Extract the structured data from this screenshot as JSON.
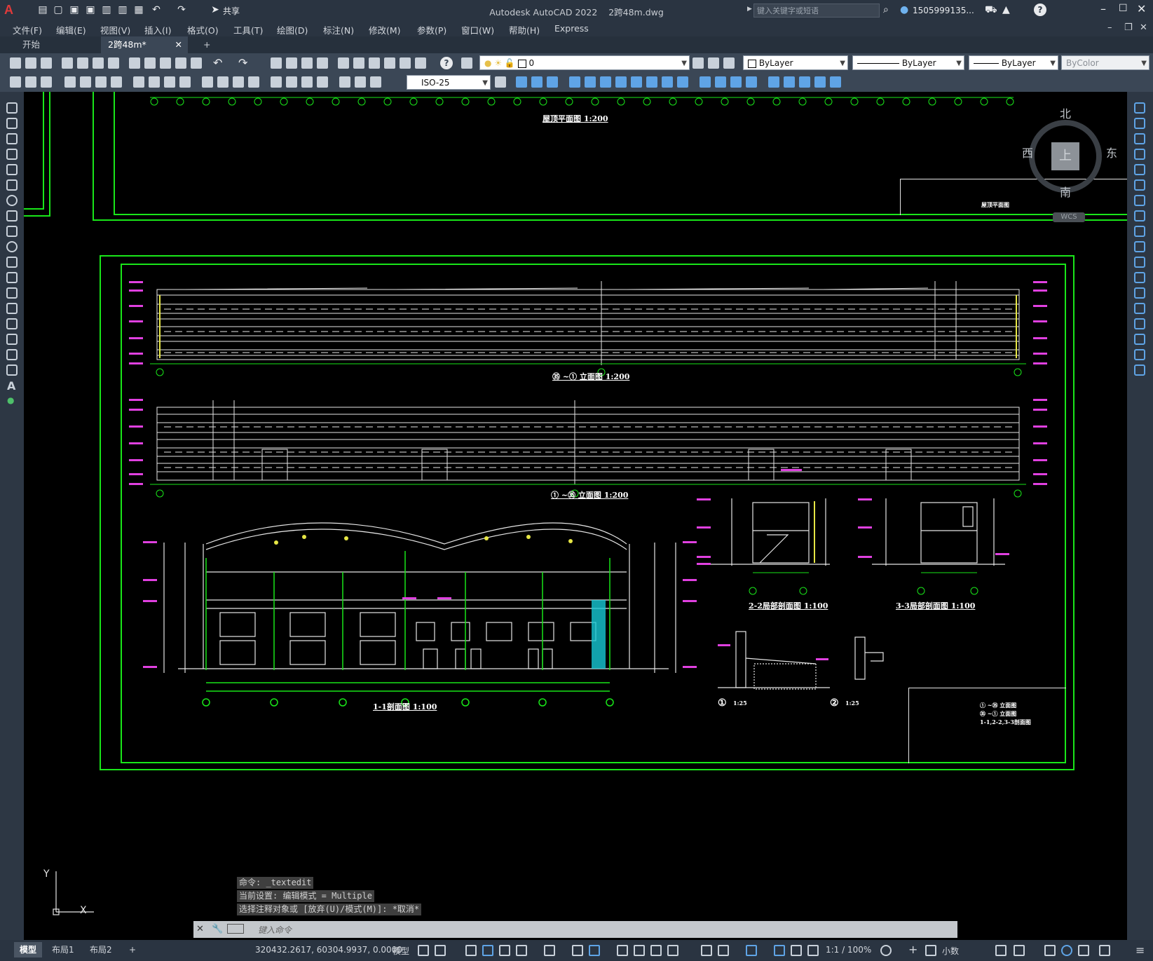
{
  "window": {
    "app_title": "Autodesk AutoCAD 2022",
    "file_name": "2跨48m.dwg",
    "search_placeholder": "键入关键字或短语",
    "user": "1505999135...",
    "share_label": "共享"
  },
  "menu": [
    "文件(F)",
    "编辑(E)",
    "视图(V)",
    "插入(I)",
    "格式(O)",
    "工具(T)",
    "绘图(D)",
    "标注(N)",
    "修改(M)",
    "参数(P)",
    "窗口(W)",
    "帮助(H)",
    "Express"
  ],
  "tabs": {
    "start": "开始",
    "active": "2跨48m*",
    "add": "+"
  },
  "properties": {
    "layer": "0",
    "color": "ByLayer",
    "linetype": "ByLayer",
    "lineweight": "ByLayer",
    "plotstyle": "ByColor",
    "dimstyle": "ISO-25"
  },
  "viewcube": {
    "north": "北",
    "south": "南",
    "east": "东",
    "west": "西",
    "top": "上",
    "wcs": "WCS"
  },
  "ucs": {
    "x": "X",
    "y": "Y"
  },
  "drawing": {
    "roof_plan_title": "屋顶平面图 1:200",
    "roof_plan_stamp": "屋顶平面图",
    "elevation1_title": "㉟ ~① 立面图 1:200",
    "elevation2_title": "① ~㉟ 立面图 1:200",
    "section11_title": "1-1剖面图 1:100",
    "section22_title": "2-2局部剖面图 1:100",
    "section33_title": "3-3局部剖面图 1:100",
    "detail1": "①",
    "detail2": "②",
    "detail_scale": "1:25",
    "titleblock_line1": "① ~㉟ 立面图",
    "titleblock_line2": "㉟ ~① 立面图",
    "titleblock_line3": "1-1,2-2,3-3剖面图"
  },
  "command": {
    "history": [
      "命令: _textedit",
      "当前设置: 编辑模式 = Multiple",
      "选择注释对象或 [放弃(U)/模式(M)]: *取消*"
    ],
    "placeholder": "键入命令"
  },
  "status": {
    "layout_tabs": [
      "模型",
      "布局1",
      "布局2"
    ],
    "coords": "320432.2617, 60304.9937, 0.0000",
    "space": "模型",
    "scale": "1:1 / 100%",
    "units": "小数"
  },
  "colors": {
    "frame_green": "#19e619",
    "dim_magenta": "#e040e0",
    "ui_dark": "#2a3441"
  }
}
